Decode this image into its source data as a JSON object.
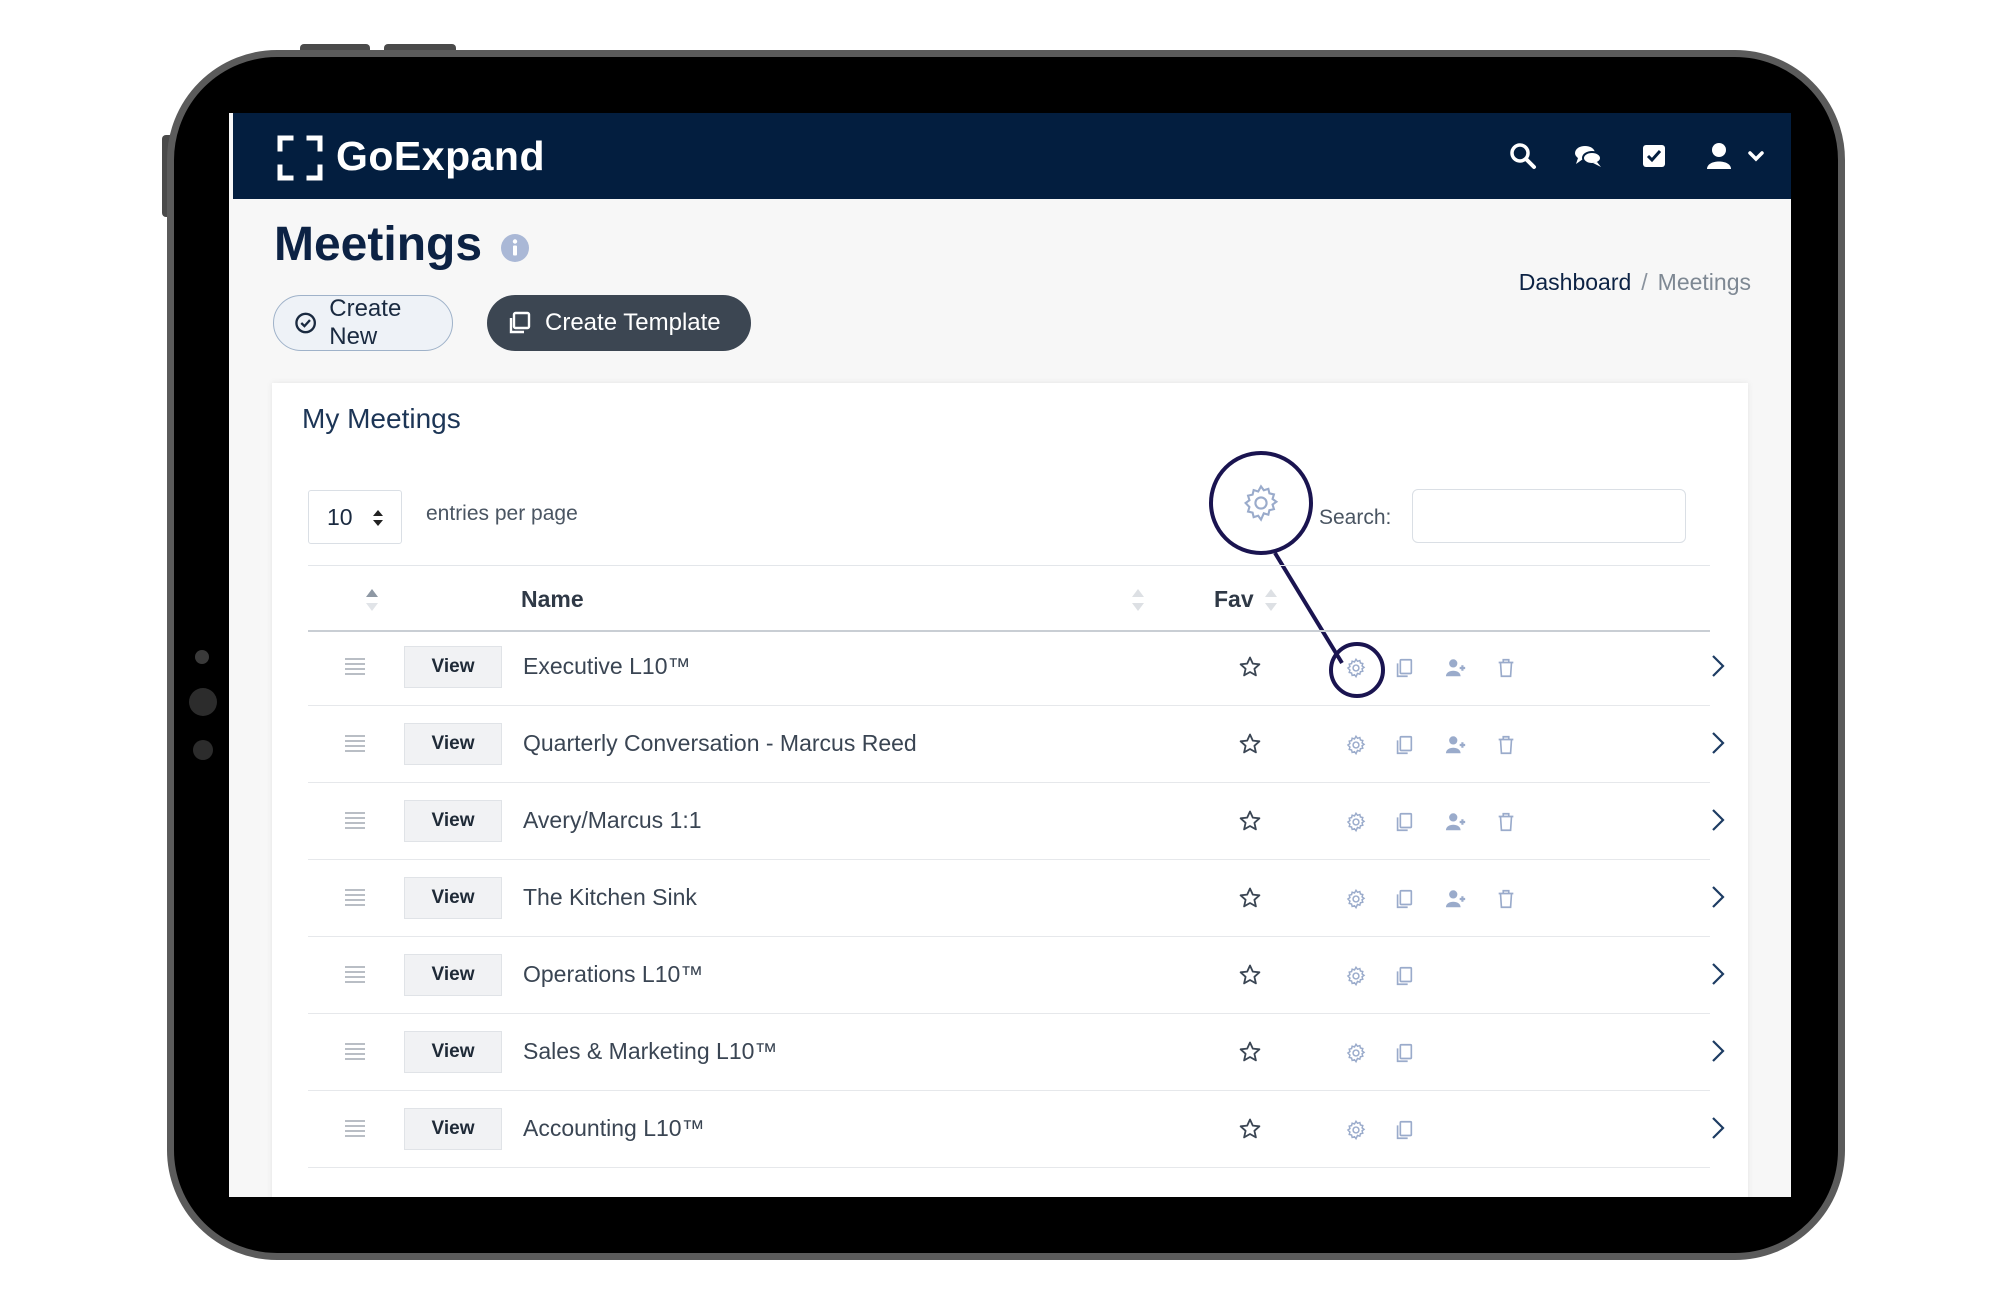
{
  "app": {
    "brand": "GoExpand"
  },
  "page": {
    "title": "Meetings"
  },
  "breadcrumb": {
    "home": "Dashboard",
    "separator": "/",
    "current": "Meetings"
  },
  "actions": {
    "create_new": "Create New",
    "create_template": "Create Template"
  },
  "card": {
    "title": "My Meetings",
    "entries_value": "10",
    "entries_label": "entries per page",
    "search_label": "Search:",
    "search_value": ""
  },
  "table": {
    "headers": {
      "name": "Name",
      "fav": "Fav"
    },
    "view_label": "View",
    "rows": [
      {
        "name": "Executive L10™",
        "add_user": true,
        "delete": true
      },
      {
        "name": "Quarterly Conversation - Marcus Reed",
        "add_user": true,
        "delete": true
      },
      {
        "name": "Avery/Marcus 1:1",
        "add_user": true,
        "delete": true
      },
      {
        "name": "The Kitchen Sink",
        "add_user": true,
        "delete": true
      },
      {
        "name": "Operations L10™",
        "add_user": false,
        "delete": false
      },
      {
        "name": "Sales & Marketing L10™",
        "add_user": false,
        "delete": false
      },
      {
        "name": "Accounting L10™",
        "add_user": false,
        "delete": false
      }
    ]
  },
  "colors": {
    "navbar": "#031e3f",
    "primary_text": "#0c2244",
    "template_button": "#3c4652",
    "action_icon": "#9aabcb",
    "callout": "#1a1450"
  },
  "icons": {
    "nav": [
      "search-icon",
      "chat-icon",
      "checkbox-icon",
      "user-icon",
      "chevron-down-icon"
    ],
    "row_actions": [
      "gear-icon",
      "copy-icon",
      "add-user-icon",
      "trash-icon"
    ]
  }
}
